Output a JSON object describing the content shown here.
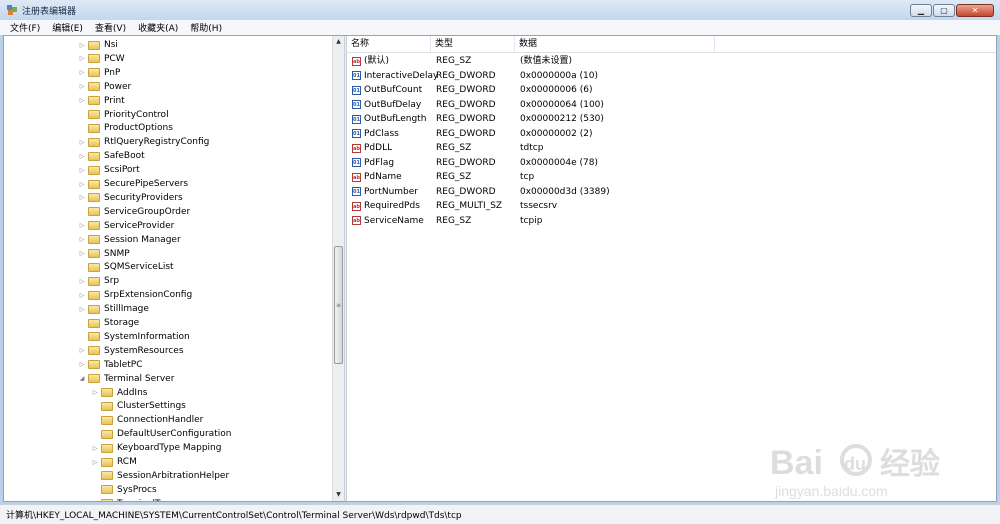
{
  "window": {
    "title": "注册表编辑器"
  },
  "menu": [
    "文件(F)",
    "编辑(E)",
    "查看(V)",
    "收藏夹(A)",
    "帮助(H)"
  ],
  "tree": [
    {
      "label": "Nsi",
      "expander": "▷",
      "level": 0
    },
    {
      "label": "PCW",
      "expander": "▷",
      "level": 0
    },
    {
      "label": "PnP",
      "expander": "▷",
      "level": 0
    },
    {
      "label": "Power",
      "expander": "▷",
      "level": 0
    },
    {
      "label": "Print",
      "expander": "▷",
      "level": 0
    },
    {
      "label": "PriorityControl",
      "expander": "",
      "level": 0
    },
    {
      "label": "ProductOptions",
      "expander": "",
      "level": 0
    },
    {
      "label": "RtlQueryRegistryConfig",
      "expander": "▷",
      "level": 0
    },
    {
      "label": "SafeBoot",
      "expander": "▷",
      "level": 0
    },
    {
      "label": "ScsiPort",
      "expander": "▷",
      "level": 0
    },
    {
      "label": "SecurePipeServers",
      "expander": "▷",
      "level": 0
    },
    {
      "label": "SecurityProviders",
      "expander": "▷",
      "level": 0
    },
    {
      "label": "ServiceGroupOrder",
      "expander": "",
      "level": 0
    },
    {
      "label": "ServiceProvider",
      "expander": "▷",
      "level": 0
    },
    {
      "label": "Session Manager",
      "expander": "▷",
      "level": 0
    },
    {
      "label": "SNMP",
      "expander": "▷",
      "level": 0
    },
    {
      "label": "SQMServiceList",
      "expander": "",
      "level": 0
    },
    {
      "label": "Srp",
      "expander": "▷",
      "level": 0
    },
    {
      "label": "SrpExtensionConfig",
      "expander": "▷",
      "level": 0
    },
    {
      "label": "StillImage",
      "expander": "▷",
      "level": 0
    },
    {
      "label": "Storage",
      "expander": "",
      "level": 0
    },
    {
      "label": "SystemInformation",
      "expander": "",
      "level": 0
    },
    {
      "label": "SystemResources",
      "expander": "▷",
      "level": 0
    },
    {
      "label": "TabletPC",
      "expander": "▷",
      "level": 0
    },
    {
      "label": "Terminal Server",
      "expander": "◢",
      "level": 0
    },
    {
      "label": "AddIns",
      "expander": "▷",
      "level": 1
    },
    {
      "label": "ClusterSettings",
      "expander": "",
      "level": 1
    },
    {
      "label": "ConnectionHandler",
      "expander": "",
      "level": 1
    },
    {
      "label": "DefaultUserConfiguration",
      "expander": "",
      "level": 1
    },
    {
      "label": "KeyboardType Mapping",
      "expander": "▷",
      "level": 1
    },
    {
      "label": "RCM",
      "expander": "▷",
      "level": 1
    },
    {
      "label": "SessionArbitrationHelper",
      "expander": "",
      "level": 1
    },
    {
      "label": "SysProcs",
      "expander": "",
      "level": 1
    },
    {
      "label": "TerminalTypes",
      "expander": "▷",
      "level": 1
    }
  ],
  "list": {
    "columns": [
      "名称",
      "类型",
      "数据"
    ],
    "rows": [
      {
        "name": "(默认)",
        "type": "REG_SZ",
        "data": "(数值未设置)",
        "icon": "string-value-icon"
      },
      {
        "name": "InteractiveDelay",
        "type": "REG_DWORD",
        "data": "0x0000000a (10)",
        "icon": "dword-value-icon"
      },
      {
        "name": "OutBufCount",
        "type": "REG_DWORD",
        "data": "0x00000006 (6)",
        "icon": "dword-value-icon"
      },
      {
        "name": "OutBufDelay",
        "type": "REG_DWORD",
        "data": "0x00000064 (100)",
        "icon": "dword-value-icon"
      },
      {
        "name": "OutBufLength",
        "type": "REG_DWORD",
        "data": "0x00000212 (530)",
        "icon": "dword-value-icon"
      },
      {
        "name": "PdClass",
        "type": "REG_DWORD",
        "data": "0x00000002 (2)",
        "icon": "dword-value-icon"
      },
      {
        "name": "PdDLL",
        "type": "REG_SZ",
        "data": "tdtcp",
        "icon": "string-value-icon"
      },
      {
        "name": "PdFlag",
        "type": "REG_DWORD",
        "data": "0x0000004e (78)",
        "icon": "dword-value-icon"
      },
      {
        "name": "PdName",
        "type": "REG_SZ",
        "data": "tcp",
        "icon": "string-value-icon"
      },
      {
        "name": "PortNumber",
        "type": "REG_DWORD",
        "data": "0x00000d3d (3389)",
        "icon": "dword-value-icon"
      },
      {
        "name": "RequiredPds",
        "type": "REG_MULTI_SZ",
        "data": "tssecsrv",
        "icon": "string-value-icon"
      },
      {
        "name": "ServiceName",
        "type": "REG_SZ",
        "data": "tcpip",
        "icon": "string-value-icon"
      }
    ]
  },
  "status": {
    "path": "计算机\\HKEY_LOCAL_MACHINE\\SYSTEM\\CurrentControlSet\\Control\\Terminal Server\\Wds\\rdpwd\\Tds\\tcp"
  },
  "watermark": {
    "brand": "Bai",
    "brand2": "du",
    "brand_cn": "经验",
    "url": "jingyan.baidu.com"
  }
}
